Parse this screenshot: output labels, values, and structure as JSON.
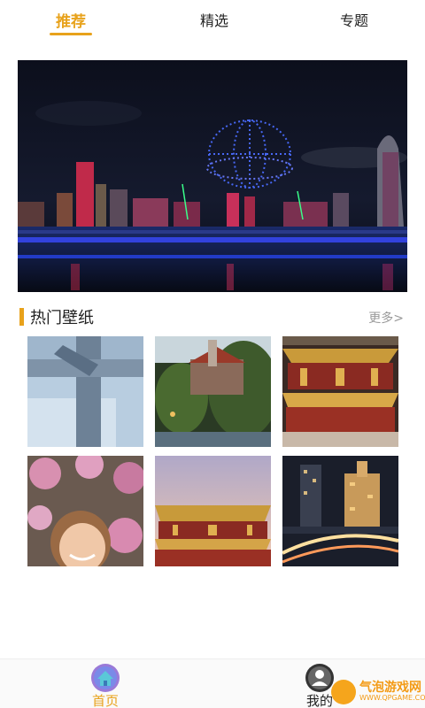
{
  "tabs": [
    {
      "label": "推荐",
      "active": true
    },
    {
      "label": "精选",
      "active": false
    },
    {
      "label": "专题",
      "active": false
    }
  ],
  "section": {
    "title": "热门壁纸",
    "more": "更多>"
  },
  "wallpapers": [
    {
      "subject": "gift box"
    },
    {
      "subject": "castle on island"
    },
    {
      "subject": "palace hall"
    },
    {
      "subject": "smiling woman with blossoms"
    },
    {
      "subject": "palace roof at dusk"
    },
    {
      "subject": "city night traffic"
    }
  ],
  "bottom_nav": [
    {
      "label": "首页",
      "icon": "home-icon",
      "active": true
    },
    {
      "label": "我的",
      "icon": "user-icon",
      "active": false
    }
  ],
  "watermark": {
    "text": "气泡游戏网",
    "url": "WWW.QPGAME.COM"
  },
  "colors": {
    "accent": "#e8a21b",
    "muted": "#999999"
  }
}
